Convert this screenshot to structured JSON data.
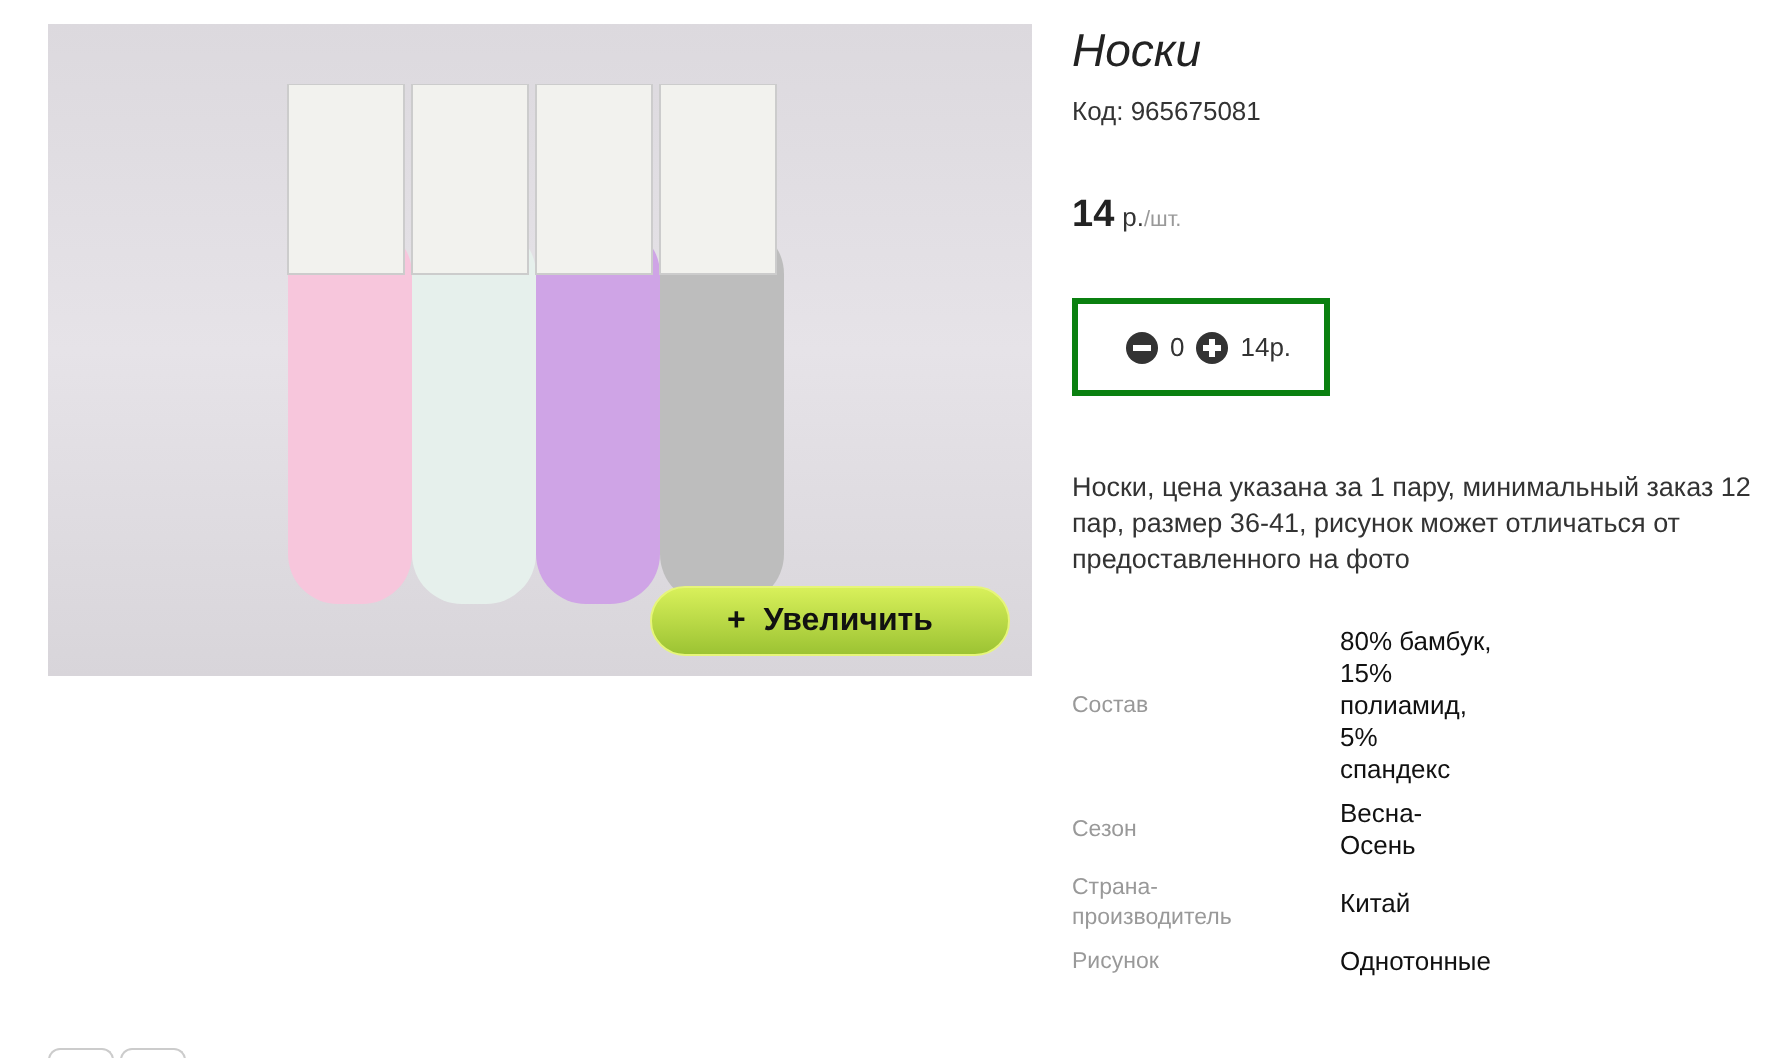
{
  "photo": {
    "zoom_button": "+  Увеличить"
  },
  "product": {
    "title": "Носки",
    "code": "Код: 965675081",
    "price": "14",
    "unit_prefix": "р.",
    "unit_suffix": "/шт."
  },
  "quantity": {
    "value": "0",
    "total": "14р."
  },
  "description": "Носки, цена указана за 1 пару, минимальный заказ 12 пар, размер 36-41, рисунок может отличаться от предоставленного на фото",
  "specs": [
    {
      "label": "Состав",
      "value": [
        "80% бамбук,",
        "15%",
        "полиамид,",
        "5%",
        "спандекс"
      ]
    },
    {
      "label": "Сезон",
      "value": [
        "Весна-",
        "Осень"
      ]
    },
    {
      "label": "Страна-производитель",
      "value": [
        "Китай"
      ]
    },
    {
      "label": "Рисунок",
      "value": [
        "Однотонные"
      ]
    }
  ]
}
